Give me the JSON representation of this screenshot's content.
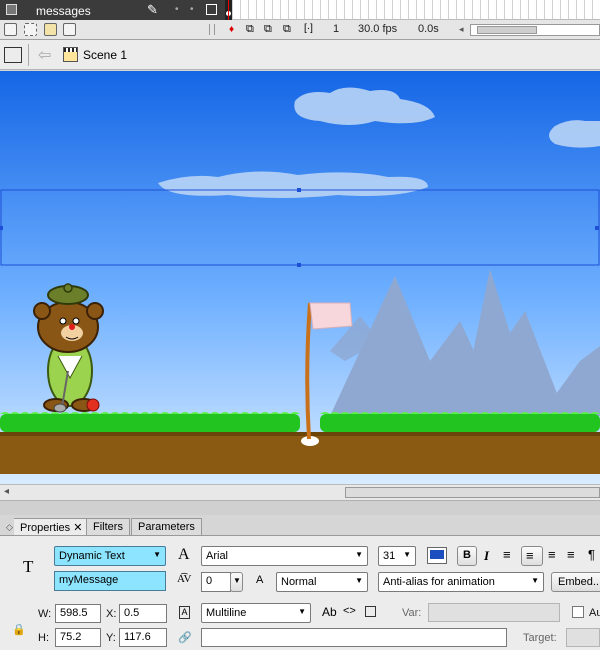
{
  "timeline": {
    "layer_name": "messages",
    "pencil_icon": "✎",
    "frame_number": "1",
    "fps": "30.0 fps",
    "elapsed": "0.0s"
  },
  "edit_bar": {
    "scene_label": "Scene 1"
  },
  "properties": {
    "tabs": [
      {
        "label": "Properties ✕"
      },
      {
        "label": "Filters"
      },
      {
        "label": "Parameters"
      }
    ],
    "text_type": "Dynamic Text",
    "instance_name": "myMessage",
    "font_family": "Arial",
    "font_size": "31",
    "text_color": "#1b4fbf",
    "bold_label": "B",
    "italic_label": "I",
    "letter_spacing": "0",
    "char_position": "Normal",
    "anti_alias": "Anti-alias for animation",
    "embed_label": "Embed...",
    "line_type": "Multiline",
    "var_label": "Var:",
    "var_value": "",
    "target_label": "Target:",
    "auto_kern_label": "Au",
    "w_label": "W:",
    "w_value": "598.5",
    "h_label": "H:",
    "h_value": "75.2",
    "x_label": "X:",
    "x_value": "0.5",
    "y_label": "Y:",
    "y_value": "117.6",
    "url_value": "",
    "target_value": ""
  },
  "icons": {
    "text_tool": "T",
    "font_glyph": "A",
    "size_glyph": "A",
    "scroll_left": "◂",
    "back_arrow": "⇦"
  }
}
